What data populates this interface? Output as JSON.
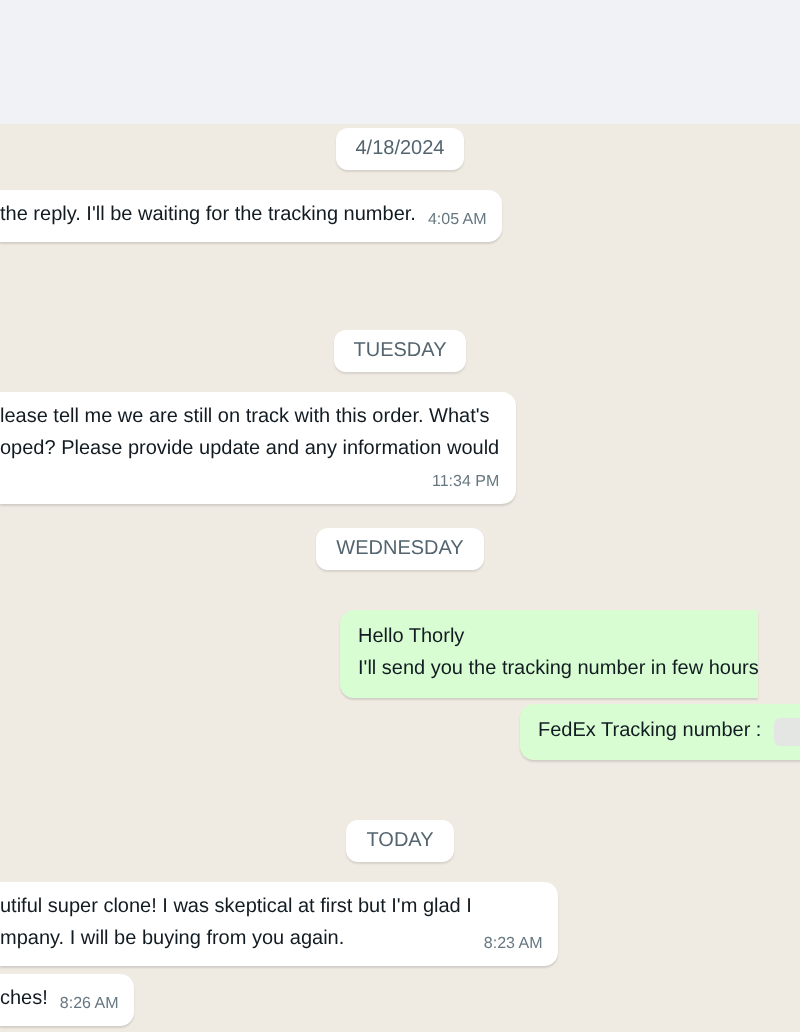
{
  "chat": [
    {
      "kind": "date",
      "label": "4/18/2024"
    },
    {
      "kind": "incoming",
      "text": "the reply. I'll be waiting for the tracking number.",
      "time": "4:05 AM",
      "time_below": false
    },
    {
      "kind": "date",
      "label": "TUESDAY"
    },
    {
      "kind": "incoming",
      "text": "lease tell me we are still on track with this order. What's\noped? Please provide update and any information would",
      "time": "11:34 PM",
      "time_below": true
    },
    {
      "kind": "date",
      "label": "WEDNESDAY"
    },
    {
      "kind": "outgoing",
      "text": "Hello Thorly\nI'll send you the tracking number in few hours",
      "redacted": false
    },
    {
      "kind": "outgoing",
      "text": "FedEx Tracking number :",
      "redacted": true
    },
    {
      "kind": "date",
      "label": "TODAY"
    },
    {
      "kind": "incoming",
      "text": "utiful super clone! I was skeptical at first but I'm glad I\nmpany. I will be buying from you again.",
      "time": "8:23 AM",
      "time_below": false
    },
    {
      "kind": "incoming",
      "text": "ches!",
      "time": "8:26 AM",
      "time_below": false
    }
  ]
}
